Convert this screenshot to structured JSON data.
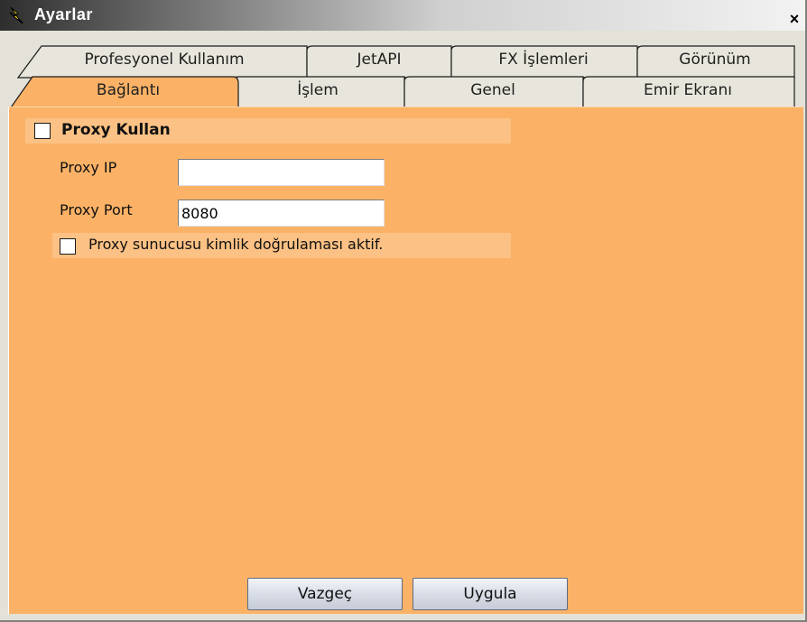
{
  "window": {
    "title": "Ayarlar",
    "close_glyph": "×"
  },
  "tabs": {
    "back_row": [
      {
        "label": "Profesyonel Kullanım"
      },
      {
        "label": "JetAPI"
      },
      {
        "label": "FX İşlemleri"
      },
      {
        "label": "Görünüm"
      }
    ],
    "front_row": [
      {
        "label": "Bağlantı",
        "active": true
      },
      {
        "label": "İşlem"
      },
      {
        "label": "Genel"
      },
      {
        "label": "Emir Ekranı"
      }
    ]
  },
  "proxy": {
    "use_proxy_label": "Proxy Kullan",
    "use_proxy_checked": false,
    "ip_label": "Proxy IP",
    "ip_value": "",
    "port_label": "Proxy Port",
    "port_value": "8080",
    "auth_label": "Proxy sunucusu kimlik doğrulaması aktif.",
    "auth_checked": false
  },
  "buttons": {
    "cancel_label": "Vazgeç",
    "apply_label": "Uygula"
  },
  "colors": {
    "panel": "#fbb266",
    "active_tab": "#fbb266",
    "inactive_tab": "#e8e6dc",
    "band": "#fcc184"
  },
  "icons": {
    "title": "lightning-icon",
    "close": "close-icon"
  }
}
